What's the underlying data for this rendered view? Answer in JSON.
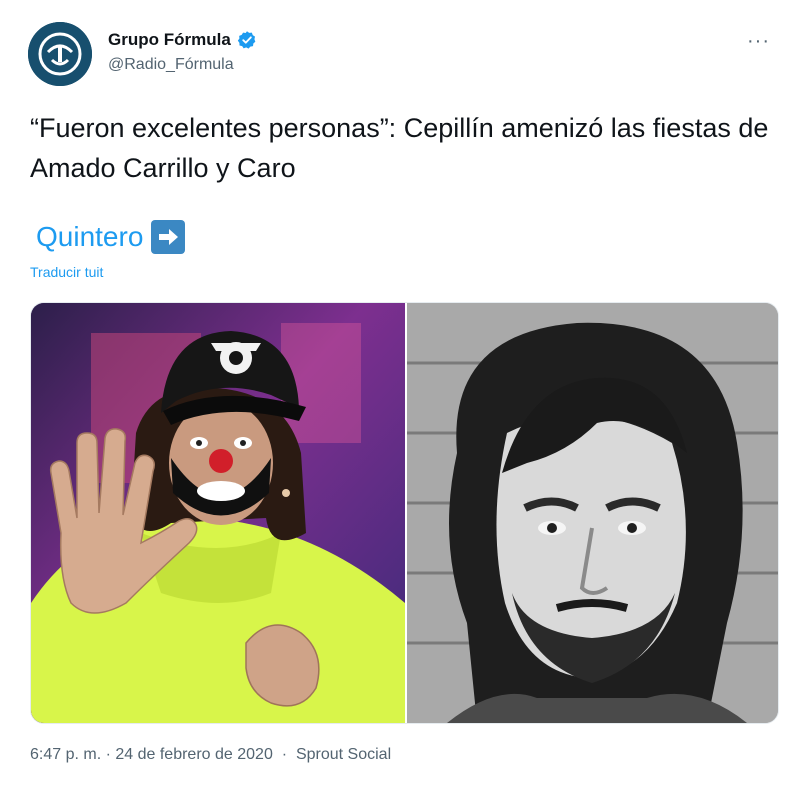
{
  "author": {
    "name": "Grupo Fórmula",
    "handle": "@Radio_Fórmula",
    "verified": true,
    "avatar_bg": "#174f6e"
  },
  "more_menu": "···",
  "tweet": {
    "text": "“Fueron excelentes personas”: Cepillín amenizó las fiestas de Amado Carrillo y Caro",
    "link_text": "Quintero",
    "link_emoji": "arrow-right-emoji",
    "translate_label": "Traducir tuit"
  },
  "media": {
    "left_photo": "clown-with-raised-hand-photo",
    "right_photo": "black-and-white-mugshot-photo"
  },
  "meta": {
    "time": "6:47 p. m.",
    "separator": " · ",
    "date": "24 de febrero de 2020",
    "separator2": "  ·  ",
    "source": "Sprout Social"
  },
  "colors": {
    "link": "#1d9bf0",
    "secondary_text": "#536471",
    "verified": "#1d9bf0"
  }
}
